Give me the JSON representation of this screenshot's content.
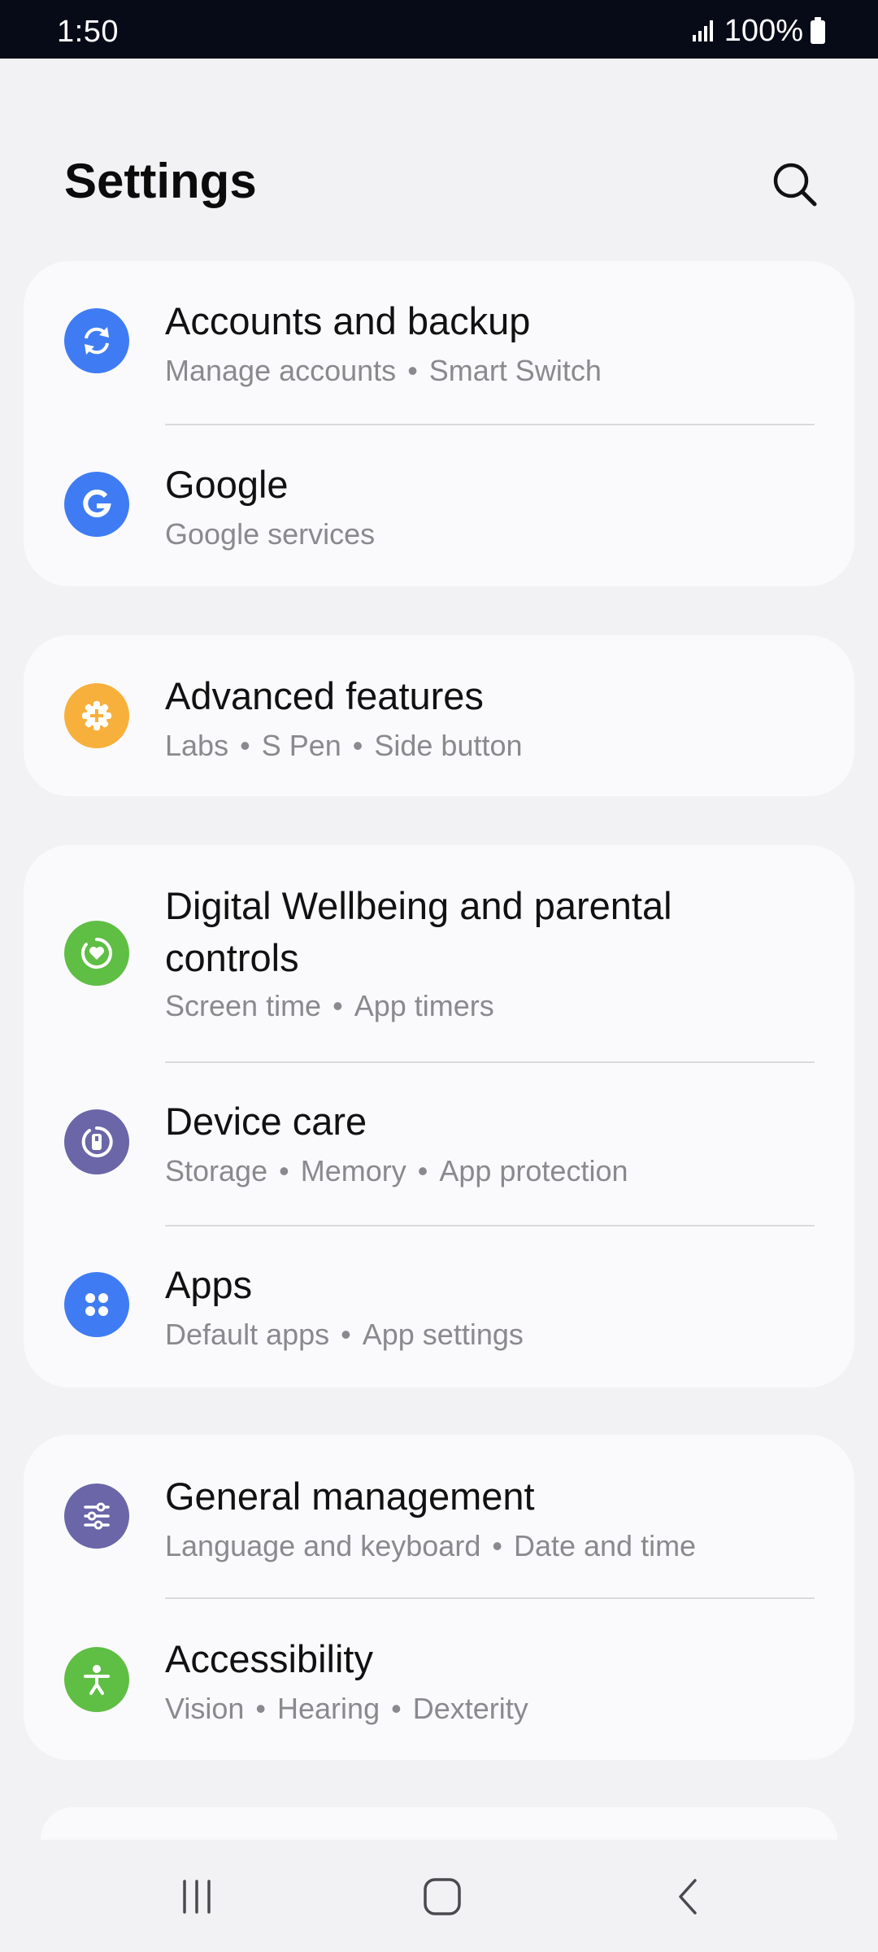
{
  "status_bar": {
    "time": "1:50",
    "battery": "100%"
  },
  "header": {
    "title": "Settings"
  },
  "groups": [
    {
      "items": [
        {
          "title": "Accounts and backup",
          "subtitle": [
            "Manage accounts",
            "Smart Switch"
          ],
          "icon": "sync-icon",
          "color": "#3f7cf4"
        },
        {
          "title": "Google",
          "subtitle": [
            "Google services"
          ],
          "icon": "google-icon",
          "color": "#3f7cf4"
        }
      ]
    },
    {
      "items": [
        {
          "title": "Advanced features",
          "subtitle": [
            "Labs",
            "S Pen",
            "Side button"
          ],
          "icon": "gear-plus-icon",
          "color": "#f8b03c"
        }
      ]
    },
    {
      "items": [
        {
          "title": "Digital Wellbeing and parental controls",
          "subtitle": [
            "Screen time",
            "App timers"
          ],
          "icon": "heart-ring-icon",
          "color": "#5fbe44"
        },
        {
          "title": "Device care",
          "subtitle": [
            "Storage",
            "Memory",
            "App protection"
          ],
          "icon": "device-care-icon",
          "color": "#6a66a8"
        },
        {
          "title": "Apps",
          "subtitle": [
            "Default apps",
            "App settings"
          ],
          "icon": "apps-grid-icon",
          "color": "#3f7cf4"
        }
      ]
    },
    {
      "items": [
        {
          "title": "General management",
          "subtitle": [
            "Language and keyboard",
            "Date and time"
          ],
          "icon": "sliders-icon",
          "color": "#6a66a8"
        },
        {
          "title": "Accessibility",
          "subtitle": [
            "Vision",
            "Hearing",
            "Dexterity"
          ],
          "icon": "accessibility-icon",
          "color": "#5fbe44"
        }
      ]
    }
  ]
}
